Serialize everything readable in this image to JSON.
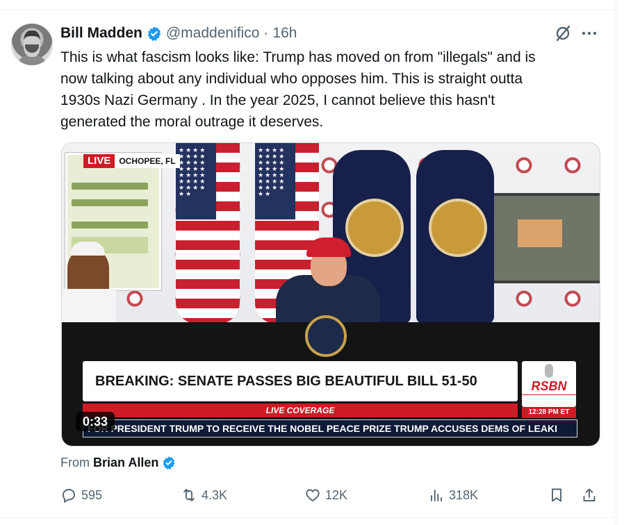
{
  "author": {
    "name": "Bill Madden",
    "handle": "@maddenifico",
    "separator": "·",
    "time": "16h"
  },
  "tweet": {
    "text": "This is what fascism looks like: Trump has moved on from \"illegals\" and is\nnow talking about any individual who opposes him. This is straight outta\n1930s Nazi Germany . In the year 2025, I cannot believe this hasn't\ngenerated the moral outrage it deserves."
  },
  "video": {
    "live_label": "LIVE",
    "location": "OCHOPEE, FL",
    "headline": "BREAKING: SENATE PASSES BIG BEAUTIFUL BILL 51-50",
    "coverage": "LIVE COVERAGE",
    "network": "RSBN",
    "clock": "12:28 PM ET",
    "ticker": "FOR PRESIDENT TRUMP TO RECEIVE THE NOBEL PEACE PRIZE    TRUMP ACCUSES DEMS OF LEAKI",
    "duration": "0:33"
  },
  "source": {
    "prefix": "From",
    "name": "Brian Allen"
  },
  "actions": {
    "replies": "595",
    "reposts": "4.3K",
    "likes": "12K",
    "views": "318K"
  },
  "icons": [
    "verified-badge-icon",
    "grok-icon",
    "more-icon",
    "reply-icon",
    "repost-icon",
    "like-icon",
    "views-icon",
    "bookmark-icon",
    "share-icon"
  ],
  "colors": {
    "verified": "#1d9bf0",
    "secondary_text": "#536471",
    "primary_text": "#0f1419",
    "live_red": "#cf1b26"
  }
}
